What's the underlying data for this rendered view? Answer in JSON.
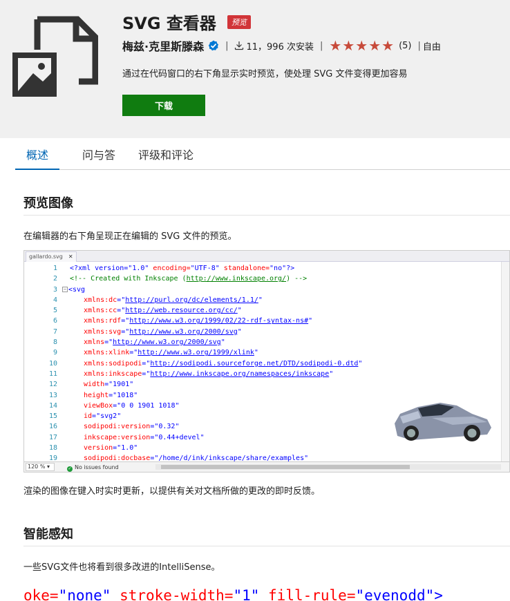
{
  "header": {
    "title": "SVG 查看器",
    "badge": "预览",
    "publisher": "梅兹·克里斯滕森",
    "installs": "11，996 次安装",
    "rating_count": "(5)",
    "rating_stars": 5,
    "price": "自由",
    "description": "通过在代码窗口的右下角显示实时预览，使处理 SVG 文件变得更加容易",
    "download_label": "下载",
    "accent_color": "#107c10",
    "badge_color": "#d13438",
    "star_color": "#c74a3a"
  },
  "tabs": [
    {
      "label": "概述",
      "active": true
    },
    {
      "label": "问与答",
      "active": false
    },
    {
      "label": "评级和评论",
      "active": false
    }
  ],
  "sections": {
    "preview_title": "预览图像",
    "preview_text": "在编辑器的右下角呈现正在编辑的 SVG 文件的预览。",
    "after_text": "渲染的图像在键入时实时更新，以提供有关对文档所做的更改的即时反馈。",
    "intellisense_title": "智能感知",
    "intellisense_text": "一些SVG文件也将看到很多改进的IntelliSense。"
  },
  "editor": {
    "tab_name": "gallardo.svg",
    "zoom": "120 %",
    "status": "No issues found",
    "lines": [
      "1",
      "2",
      "3",
      "4",
      "5",
      "6",
      "7",
      "8",
      "9",
      "10",
      "11",
      "12",
      "13",
      "14",
      "15",
      "16",
      "17",
      "18",
      "19"
    ],
    "code": {
      "l1_a": "<?xml version=",
      "l1_b": "\"1.0\"",
      "l1_c": " encoding=",
      "l1_d": "\"UTF-8\"",
      "l1_e": " standalone=",
      "l1_f": "\"no\"",
      "l1_g": "?>",
      "l2_a": "<!-- Created with Inkscape (",
      "l2_b": "http://www.inkscape.org/",
      "l2_c": ") -->",
      "l3": "<svg",
      "a4": "xmlns:dc",
      "v4": "http://purl.org/dc/elements/1.1/",
      "a5": "xmlns:cc",
      "v5": "http://web.resource.org/cc/",
      "a6": "xmlns:rdf",
      "v6": "http://www.w3.org/1999/02/22-rdf-syntax-ns#",
      "a7": "xmlns:svg",
      "v7": "http://www.w3.org/2000/svg",
      "a8": "xmlns",
      "v8": "http://www.w3.org/2000/svg",
      "a9": "xmlns:xlink",
      "v9": "http://www.w3.org/1999/xlink",
      "a10": "xmlns:sodipodi",
      "v10": "http://sodipodi.sourceforge.net/DTD/sodipodi-0.dtd",
      "a11": "xmlns:inkscape",
      "v11": "http://www.inkscape.org/namespaces/inkscape",
      "a12": "width",
      "v12": "1901",
      "a13": "height",
      "v13": "1018",
      "a14": "viewBox",
      "v14": "0 0 1901 1018",
      "a15": "id",
      "v15": "svg2",
      "a16": "sodipodi:version",
      "v16": "0.32",
      "a17": "inkscape:version",
      "v17": "0.44+devel",
      "a18": "version",
      "v18": "1.0",
      "a19": "sodipodi:docbase",
      "v19": "/home/d/ink/inkscape/share/examples"
    }
  },
  "bottom_code": {
    "a1": "oke=",
    "v1": "\"none\"",
    "a2": " stroke-width=",
    "v2": "\"1\"",
    "a3": " fill-rule=",
    "v3": "\"evenodd\"",
    "end": ">"
  }
}
